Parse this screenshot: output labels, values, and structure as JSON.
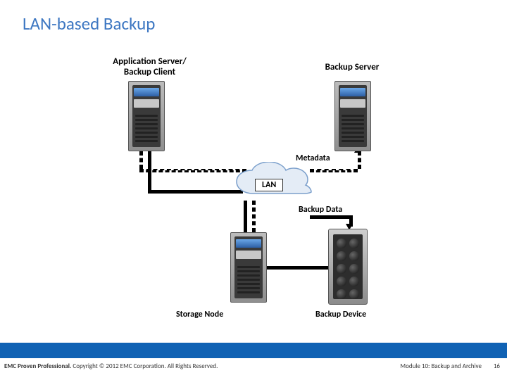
{
  "title": "LAN-based Backup",
  "labels": {
    "app_server": "Application Server/\nBackup Client",
    "backup_server": "Backup Server",
    "metadata": "Metadata",
    "lan": "LAN",
    "backup_data": "Backup Data",
    "storage_node": "Storage Node",
    "backup_device": "Backup Device"
  },
  "footer": {
    "brand": "EMC Proven Professional.",
    "copyright": " Copyright © 2012 EMC Corporation. All Rights Reserved.",
    "module": "Module 10: Backup and Archive",
    "page": "16"
  }
}
